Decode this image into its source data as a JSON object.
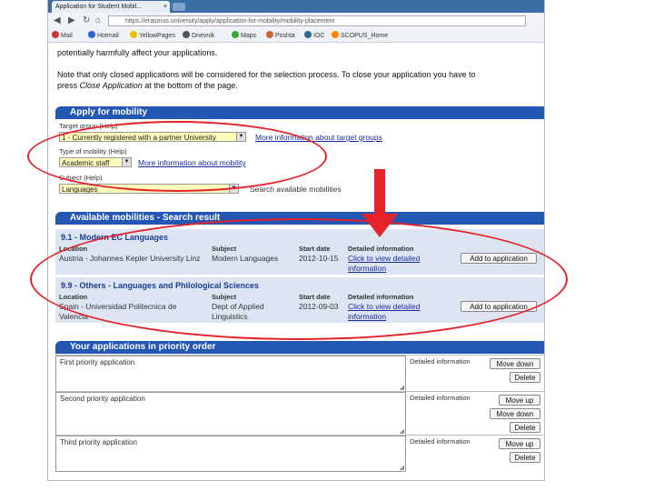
{
  "browser": {
    "tab_title": "Application for Student Mobil...",
    "tab_close": "×",
    "url": "https://erasmus.university/apply/application-for-mobility/mobility-placement",
    "bookmarks": [
      "Mail",
      "Hotmail",
      "YellowPages",
      "Dnevnik",
      "Maps",
      "Poshta",
      "IOC",
      "SCOPUS_Home"
    ]
  },
  "intro": {
    "line1": "potentially harmfully affect your applications.",
    "line2": "Note that only closed applications will be considered for the selection process. To close your application you have to",
    "line3_pre": "press ",
    "line3_em": "Close Application",
    "line3_post": " at the bottom of the page."
  },
  "apply": {
    "header": "Apply for mobility",
    "target_label": "Target group (Help)",
    "target_value": "1 - Currently registered with a partner University",
    "target_more": "More information about target groups",
    "type_label": "Type of mobility (Help)",
    "type_value": "Academic staff",
    "type_more": "More information about mobility",
    "subject_label": "Subject (Help)",
    "subject_value": "Languages",
    "search_link": "Search available mobilities"
  },
  "results": {
    "header": "Available mobilities - Search result",
    "columns": [
      "Location",
      "Subject",
      "Start date",
      "Detailed information"
    ],
    "groups": [
      {
        "title": "9.1 - Modern EC Languages",
        "location": "Austria - Johannes Kepler University Linz",
        "subject": "Modern Languages",
        "start": "2012-10-15",
        "detail": "Click to view detailed information",
        "button": "Add to application"
      },
      {
        "title": "9.9 - Others - Languages and Philological Sciences",
        "location": "Spain - Universidad Politecnica de Valencia",
        "subject": "Dept of Applied Linguistics",
        "start": "2012-09-03",
        "detail": "Click to view detailed information",
        "button": "Add to application"
      }
    ]
  },
  "priority": {
    "header": "Your applications in priority order",
    "rows": [
      {
        "label": "First priority application",
        "detail": "Detailed information",
        "buttons": [
          "Move down",
          "Delete"
        ]
      },
      {
        "label": "Second priority application",
        "detail": "Detailed information",
        "buttons": [
          "Move up",
          "Move down",
          "Delete"
        ]
      },
      {
        "label": "Third priority application",
        "detail": "Detailed information",
        "buttons": [
          "Move up",
          "Delete"
        ]
      }
    ]
  },
  "colors": {
    "header_blue": "#2457b3",
    "annotation_red": "#e4232b",
    "select_yellow": "#fffbbb",
    "group_bg": "#dde5f3"
  }
}
